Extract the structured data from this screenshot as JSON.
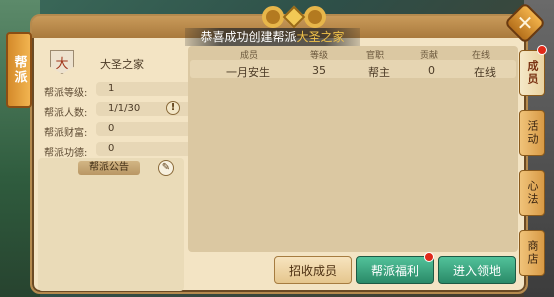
{
  "announcement": {
    "prefix": "恭喜成功创建帮派",
    "guild": "大圣之家"
  },
  "left_tab": "帮派",
  "guild": {
    "emblem_char": "大",
    "name": "大圣之家",
    "stats": [
      {
        "label": "帮派等级:",
        "value": "1"
      },
      {
        "label": "帮派人数:",
        "value": "1/1/30"
      },
      {
        "label": "帮派财富:",
        "value": "0"
      },
      {
        "label": "帮派功德:",
        "value": "0"
      }
    ],
    "notice_title": "帮派公告"
  },
  "table": {
    "headers": [
      "成员",
      "等级",
      "官职",
      "贡献",
      "在线"
    ],
    "rows": [
      {
        "member": "一月安生",
        "level": "35",
        "position": "帮主",
        "contribution": "0",
        "online": "在线"
      }
    ]
  },
  "right_tabs": [
    "成员",
    "活动",
    "心法",
    "商店"
  ],
  "buttons": {
    "recruit": "招收成员",
    "welfare": "帮派福利",
    "enter": "进入领地"
  },
  "icons": [
    "close-icon",
    "info-icon",
    "edit-icon",
    "notification-dot"
  ]
}
